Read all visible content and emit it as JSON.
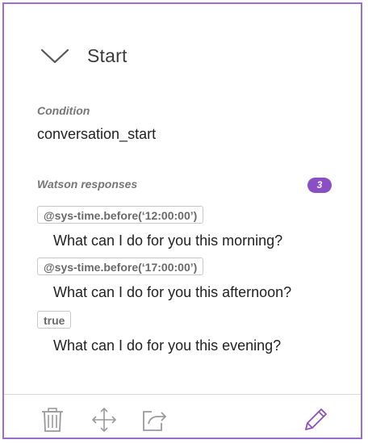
{
  "node": {
    "title": "Start",
    "condition_label": "Condition",
    "condition_value": "conversation_start",
    "responses_label": "Watson responses",
    "responses_count": "3",
    "responses": [
      {
        "condition": "@sys-time.before(‘12:00:00’)",
        "text": "What can I do for you this morning?"
      },
      {
        "condition": "@sys-time.before(‘17:00:00’)",
        "text": "What can I do for you this afternoon?"
      },
      {
        "condition": "true",
        "text": "What can I do for you this evening?"
      }
    ]
  },
  "icons": {
    "collapse": "chevron-down-icon",
    "delete": "trash-icon",
    "move": "move-icon",
    "jump": "jump-to-icon",
    "edit": "pencil-icon"
  },
  "colors": {
    "accent": "#8a4fc4",
    "border": "#9b6fcf",
    "icon_gray": "#9a9a9a"
  }
}
